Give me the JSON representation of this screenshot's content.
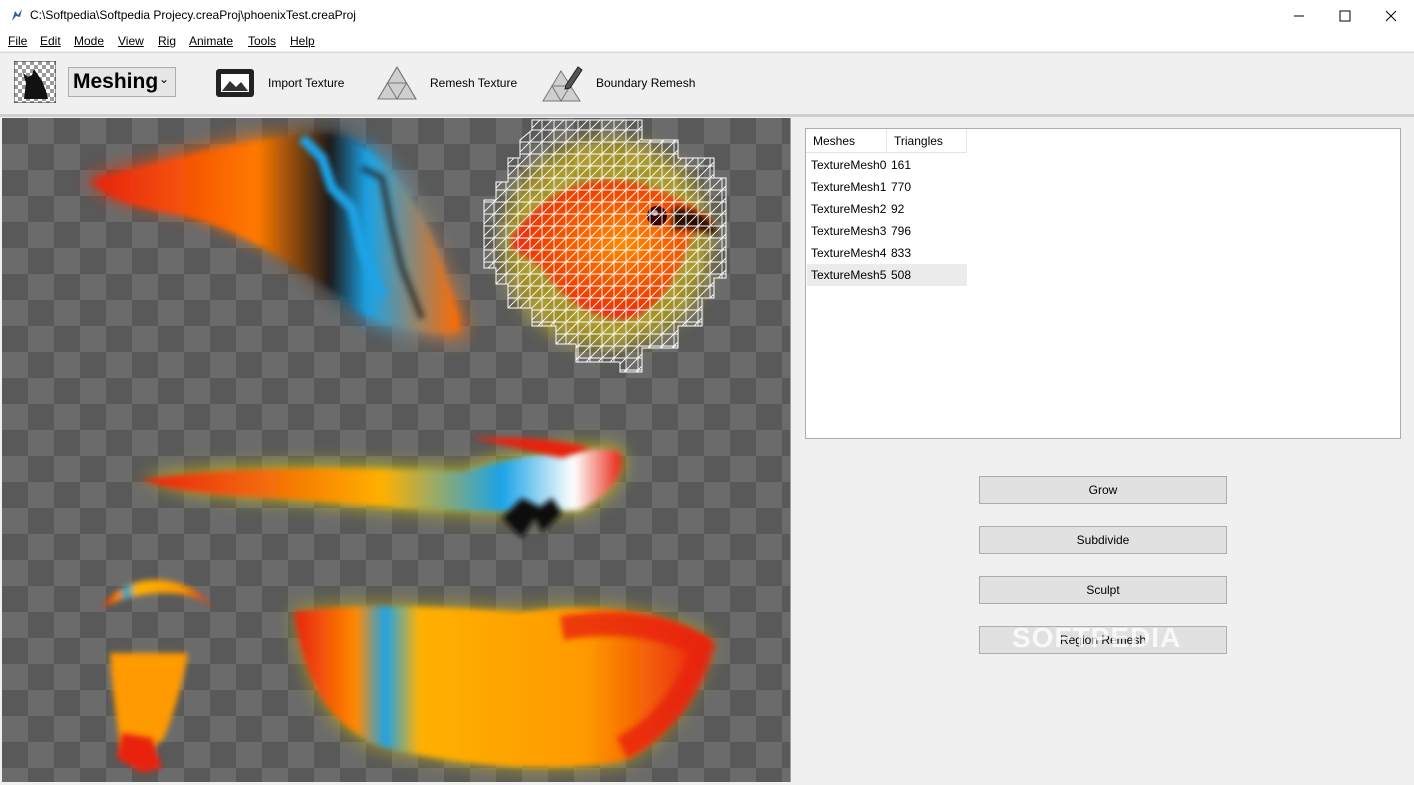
{
  "window": {
    "title": "C:\\Softpedia\\Softpedia Projecy.creaProj\\phoenixTest.creaProj"
  },
  "menu": [
    "File",
    "Edit",
    "Mode",
    "View",
    "Rig",
    "Animate",
    "Tools",
    "Help"
  ],
  "toolbar": {
    "mode_value": "Meshing",
    "import_label": "Import Texture",
    "remesh_label": "Remesh Texture",
    "boundary_label": "Boundary Remesh"
  },
  "table": {
    "headers": [
      "Meshes",
      "Triangles"
    ],
    "rows": [
      {
        "name": "TextureMesh0",
        "triangles": "161"
      },
      {
        "name": "TextureMesh1",
        "triangles": "770"
      },
      {
        "name": "TextureMesh2",
        "triangles": "92"
      },
      {
        "name": "TextureMesh3",
        "triangles": "796"
      },
      {
        "name": "TextureMesh4",
        "triangles": "833"
      },
      {
        "name": "TextureMesh5",
        "triangles": "508"
      }
    ],
    "selected_row": "TextureMesh5"
  },
  "actions": {
    "grow": "Grow",
    "subdivide": "Subdivide",
    "sculpt": "Sculpt",
    "region_remesh": "Region Remesh"
  },
  "watermark": "SOFTPEDIA",
  "colors": {
    "fire_red": "#e8220f",
    "fire_orange": "#ff8a00",
    "fire_yellow": "#ffd000",
    "feather_blue": "#1aa3e6"
  }
}
